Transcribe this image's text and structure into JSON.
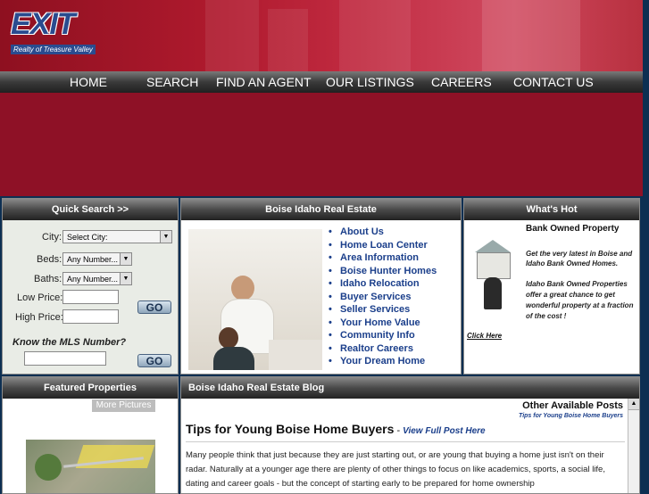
{
  "logo": {
    "mark": "EXIT",
    "tagline": "Realty of Treasure Valley"
  },
  "nav": [
    "HOME",
    "SEARCH",
    "FIND AN AGENT",
    "OUR LISTINGS",
    "CAREERS",
    "CONTACT US"
  ],
  "quick_search": {
    "title": "Quick Search >>",
    "city_label": "City:",
    "city_value": "Select City:",
    "beds_label": "Beds:",
    "beds_value": "Any Number...",
    "baths_label": "Baths:",
    "baths_value": "Any Number...",
    "low_price_label": "Low Price:",
    "high_price_label": "High Price:",
    "go": "GO",
    "mls_label": "Know the MLS Number?"
  },
  "boise": {
    "title": "Boise Idaho Real Estate",
    "links": [
      "About Us",
      "Home Loan Center",
      "Area Information",
      "Boise Hunter Homes",
      "Idaho Relocation",
      "Buyer Services",
      "Seller Services",
      "Your Home Value",
      "Community Info",
      "Realtor Careers",
      "Your Dream Home"
    ]
  },
  "whats_hot": {
    "title": "What's Hot",
    "heading": "Bank Owned Property",
    "p1": "Get the very latest in Boise and Idaho Bank Owned Homes.",
    "p2": "Idaho Bank Owned Properties offer a great chance to get wonderful property at a fraction of the cost !",
    "click": "Click Here"
  },
  "featured": {
    "title": "Featured Properties",
    "more": "More Pictures"
  },
  "blog": {
    "title": "Boise Idaho Real Estate Blog",
    "other": "Other Available Posts",
    "other_link": "Tips for Young Boise Home Buyers",
    "post_title": "Tips for Young Boise Home Buyers",
    "sep": " - ",
    "view": "View Full Post Here",
    "body": "Many people think that just because they are just starting out, or are young that buying a home just isn't on their radar. Naturally at a younger age there are plenty of other things to focus on like academics, sports, a social life, dating and career goals - but the concept of starting early to be prepared for home ownership"
  }
}
